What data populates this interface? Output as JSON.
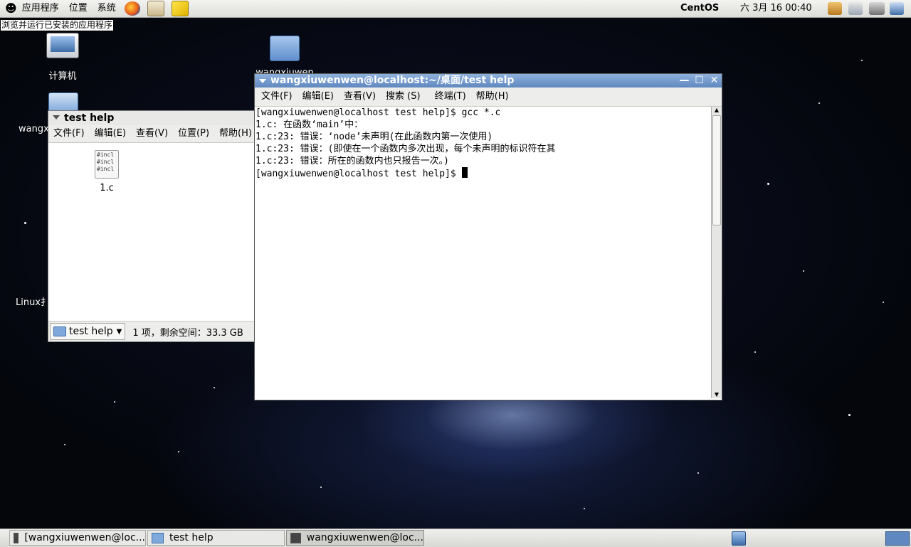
{
  "top_panel": {
    "menu_apps": "应用程序",
    "menu_places": "位置",
    "menu_system": "系统",
    "distro": "CentOS",
    "clock": "六 3月 16 00:40"
  },
  "tooltip": "浏览并运行已安装的应用程序",
  "desktop_icons": {
    "computer": "计算机",
    "home_partial": "wangx",
    "folder_partial": "wangxiuwen",
    "linux_partial": "Linux扌"
  },
  "file_manager": {
    "title": "test help",
    "menu": [
      "文件(F)",
      "编辑(E)",
      "查看(V)",
      "位置(P)",
      "帮助(H)"
    ],
    "file_name": "1.c",
    "file_preview": [
      "#incl",
      "#incl",
      "#incl"
    ],
    "location": "test help",
    "status": "1 项，剩余空间：33.3 GB"
  },
  "terminal": {
    "title": "wangxiuwenwen@localhost:~/桌面/test help",
    "menu": [
      "文件(F)",
      "编辑(E)",
      "查看(V)",
      "搜索 (S)",
      "终端(T)",
      "帮助(H)"
    ],
    "lines": [
      "[wangxiuwenwen@localhost test help]$ gcc *.c",
      "1.c: 在函数‘main’中：",
      "1.c:23: 错误：‘node’未声明(在此函数内第一次使用)",
      "1.c:23: 错误：(即使在一个函数内多次出现，每个未声明的标识符在其",
      "1.c:23: 错误：所在的函数内也只报告一次。)"
    ],
    "prompt": "[wangxiuwenwen@localhost test help]$ "
  },
  "taskbar": {
    "tasks": [
      "[wangxiuwenwen@loc...",
      "test help",
      "wangxiuwenwen@loc..."
    ]
  }
}
